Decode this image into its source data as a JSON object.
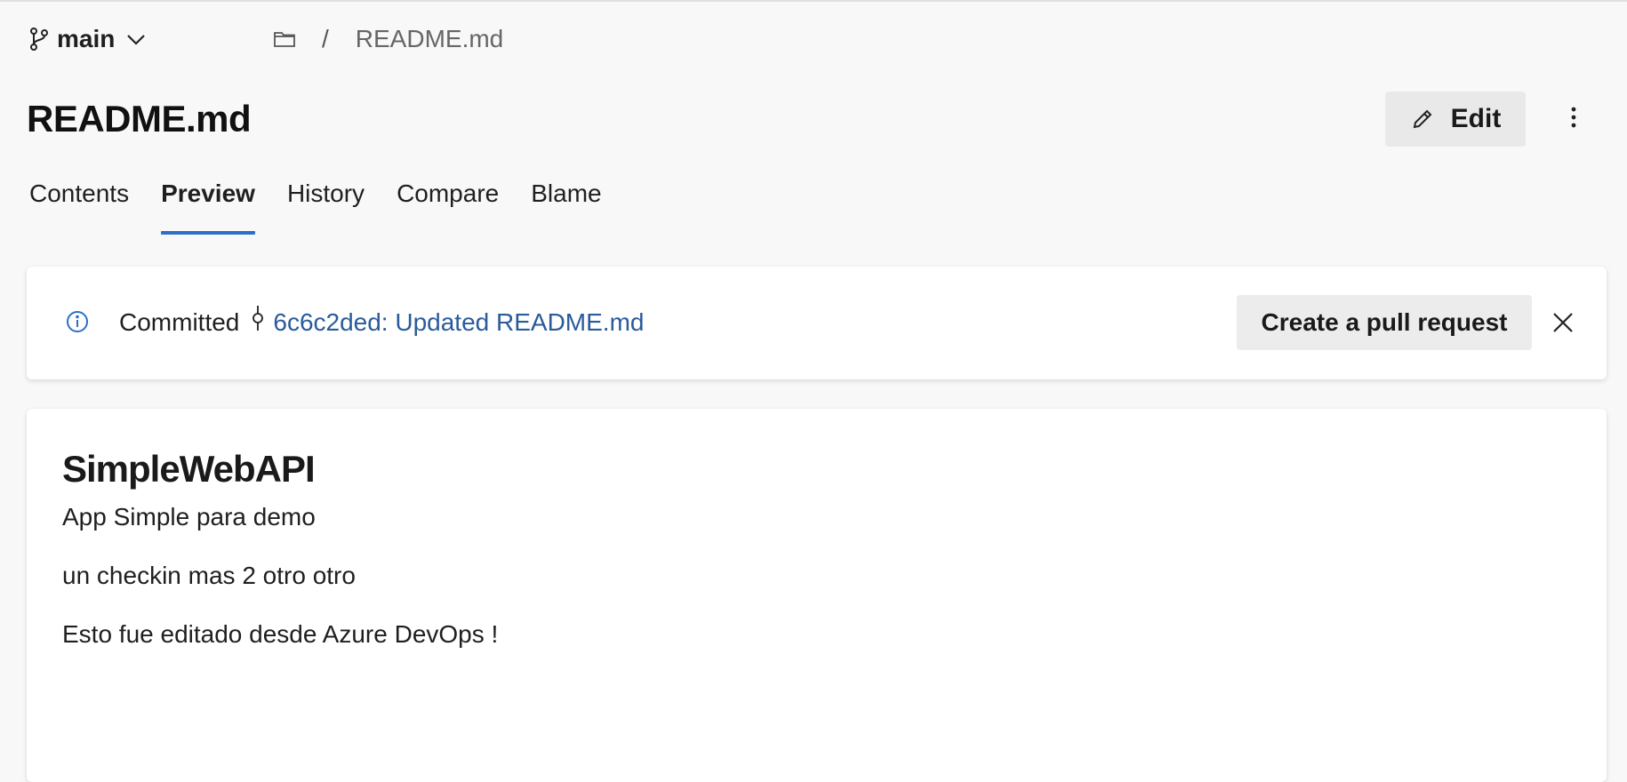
{
  "branch": {
    "name": "main",
    "icon": "branch-icon",
    "dropdown_icon": "chevron-down-icon"
  },
  "breadcrumb": {
    "folder_icon": "folder-icon",
    "separator": "/",
    "file": "README.md"
  },
  "header": {
    "title": "README.md",
    "edit_label": "Edit",
    "more_icon": "more-vertical-icon"
  },
  "tabs": [
    {
      "label": "Contents",
      "active": false
    },
    {
      "label": "Preview",
      "active": true
    },
    {
      "label": "History",
      "active": false
    },
    {
      "label": "Compare",
      "active": false
    },
    {
      "label": "Blame",
      "active": false
    }
  ],
  "banner": {
    "icon": "info-icon",
    "prefix": "Committed",
    "commit_icon": "commit-icon",
    "commit_link": "6c6c2ded: Updated README.md",
    "action_label": "Create a pull request",
    "close_icon": "close-icon"
  },
  "preview": {
    "heading": "SimpleWebAPI",
    "paragraphs": [
      "App Simple para demo",
      "un checkin mas 2 otro otro",
      "Esto fue editado desde Azure DevOps !"
    ]
  },
  "colors": {
    "accent": "#2b6fc9",
    "link": "#2a5b9a",
    "background": "#f8f8f8",
    "button_bg": "#e9e9e9"
  }
}
